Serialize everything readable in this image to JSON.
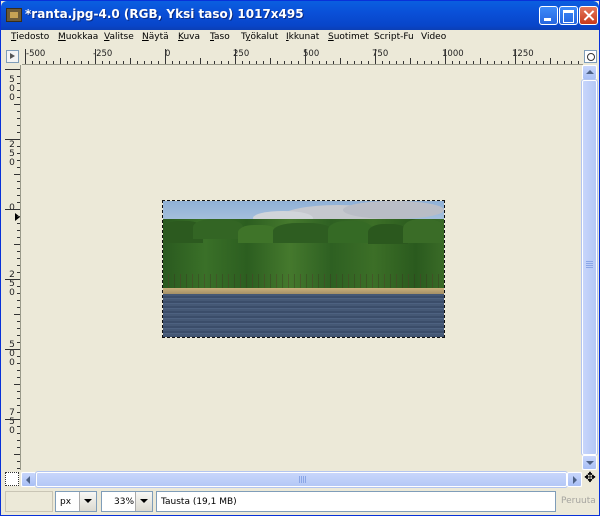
{
  "window": {
    "title": "*ranta.jpg-4.0 (RGB, Yksi taso) 1017x495",
    "icon": "gimp-image-icon"
  },
  "menubar": {
    "items": [
      {
        "prefix": "",
        "mnemonic": "T",
        "rest": "iedosto"
      },
      {
        "prefix": "",
        "mnemonic": "M",
        "rest": "uokkaa"
      },
      {
        "prefix": "",
        "mnemonic": "V",
        "rest": "alitse"
      },
      {
        "prefix": "",
        "mnemonic": "N",
        "rest": "äytä"
      },
      {
        "prefix": "",
        "mnemonic": "K",
        "rest": "uva"
      },
      {
        "prefix": "",
        "mnemonic": "T",
        "rest": "aso"
      },
      {
        "prefix": "T",
        "mnemonic": "y",
        "rest": "ökalut"
      },
      {
        "prefix": "",
        "mnemonic": "I",
        "rest": "kkunat"
      },
      {
        "prefix": "",
        "mnemonic": "S",
        "rest": "uotimet"
      },
      {
        "prefix": "",
        "mnemonic": "",
        "rest": "Script-Fu"
      },
      {
        "prefix": "",
        "mnemonic": "",
        "rest": "Video"
      }
    ]
  },
  "rulers": {
    "horizontal_labels": [
      "-500",
      "-250",
      "0",
      "250",
      "500",
      "750",
      "1000",
      "1250"
    ],
    "vertical_labels": [
      "500",
      "250",
      "0",
      "250",
      "500",
      "750"
    ]
  },
  "image": {
    "description_icon": "lake-forest-photo"
  },
  "statusbar": {
    "unit": "px",
    "zoom": "33%",
    "layer_info": "Tausta (19,1 MB)",
    "cancel": "Peruuta"
  },
  "navigate_glyph": "✥"
}
